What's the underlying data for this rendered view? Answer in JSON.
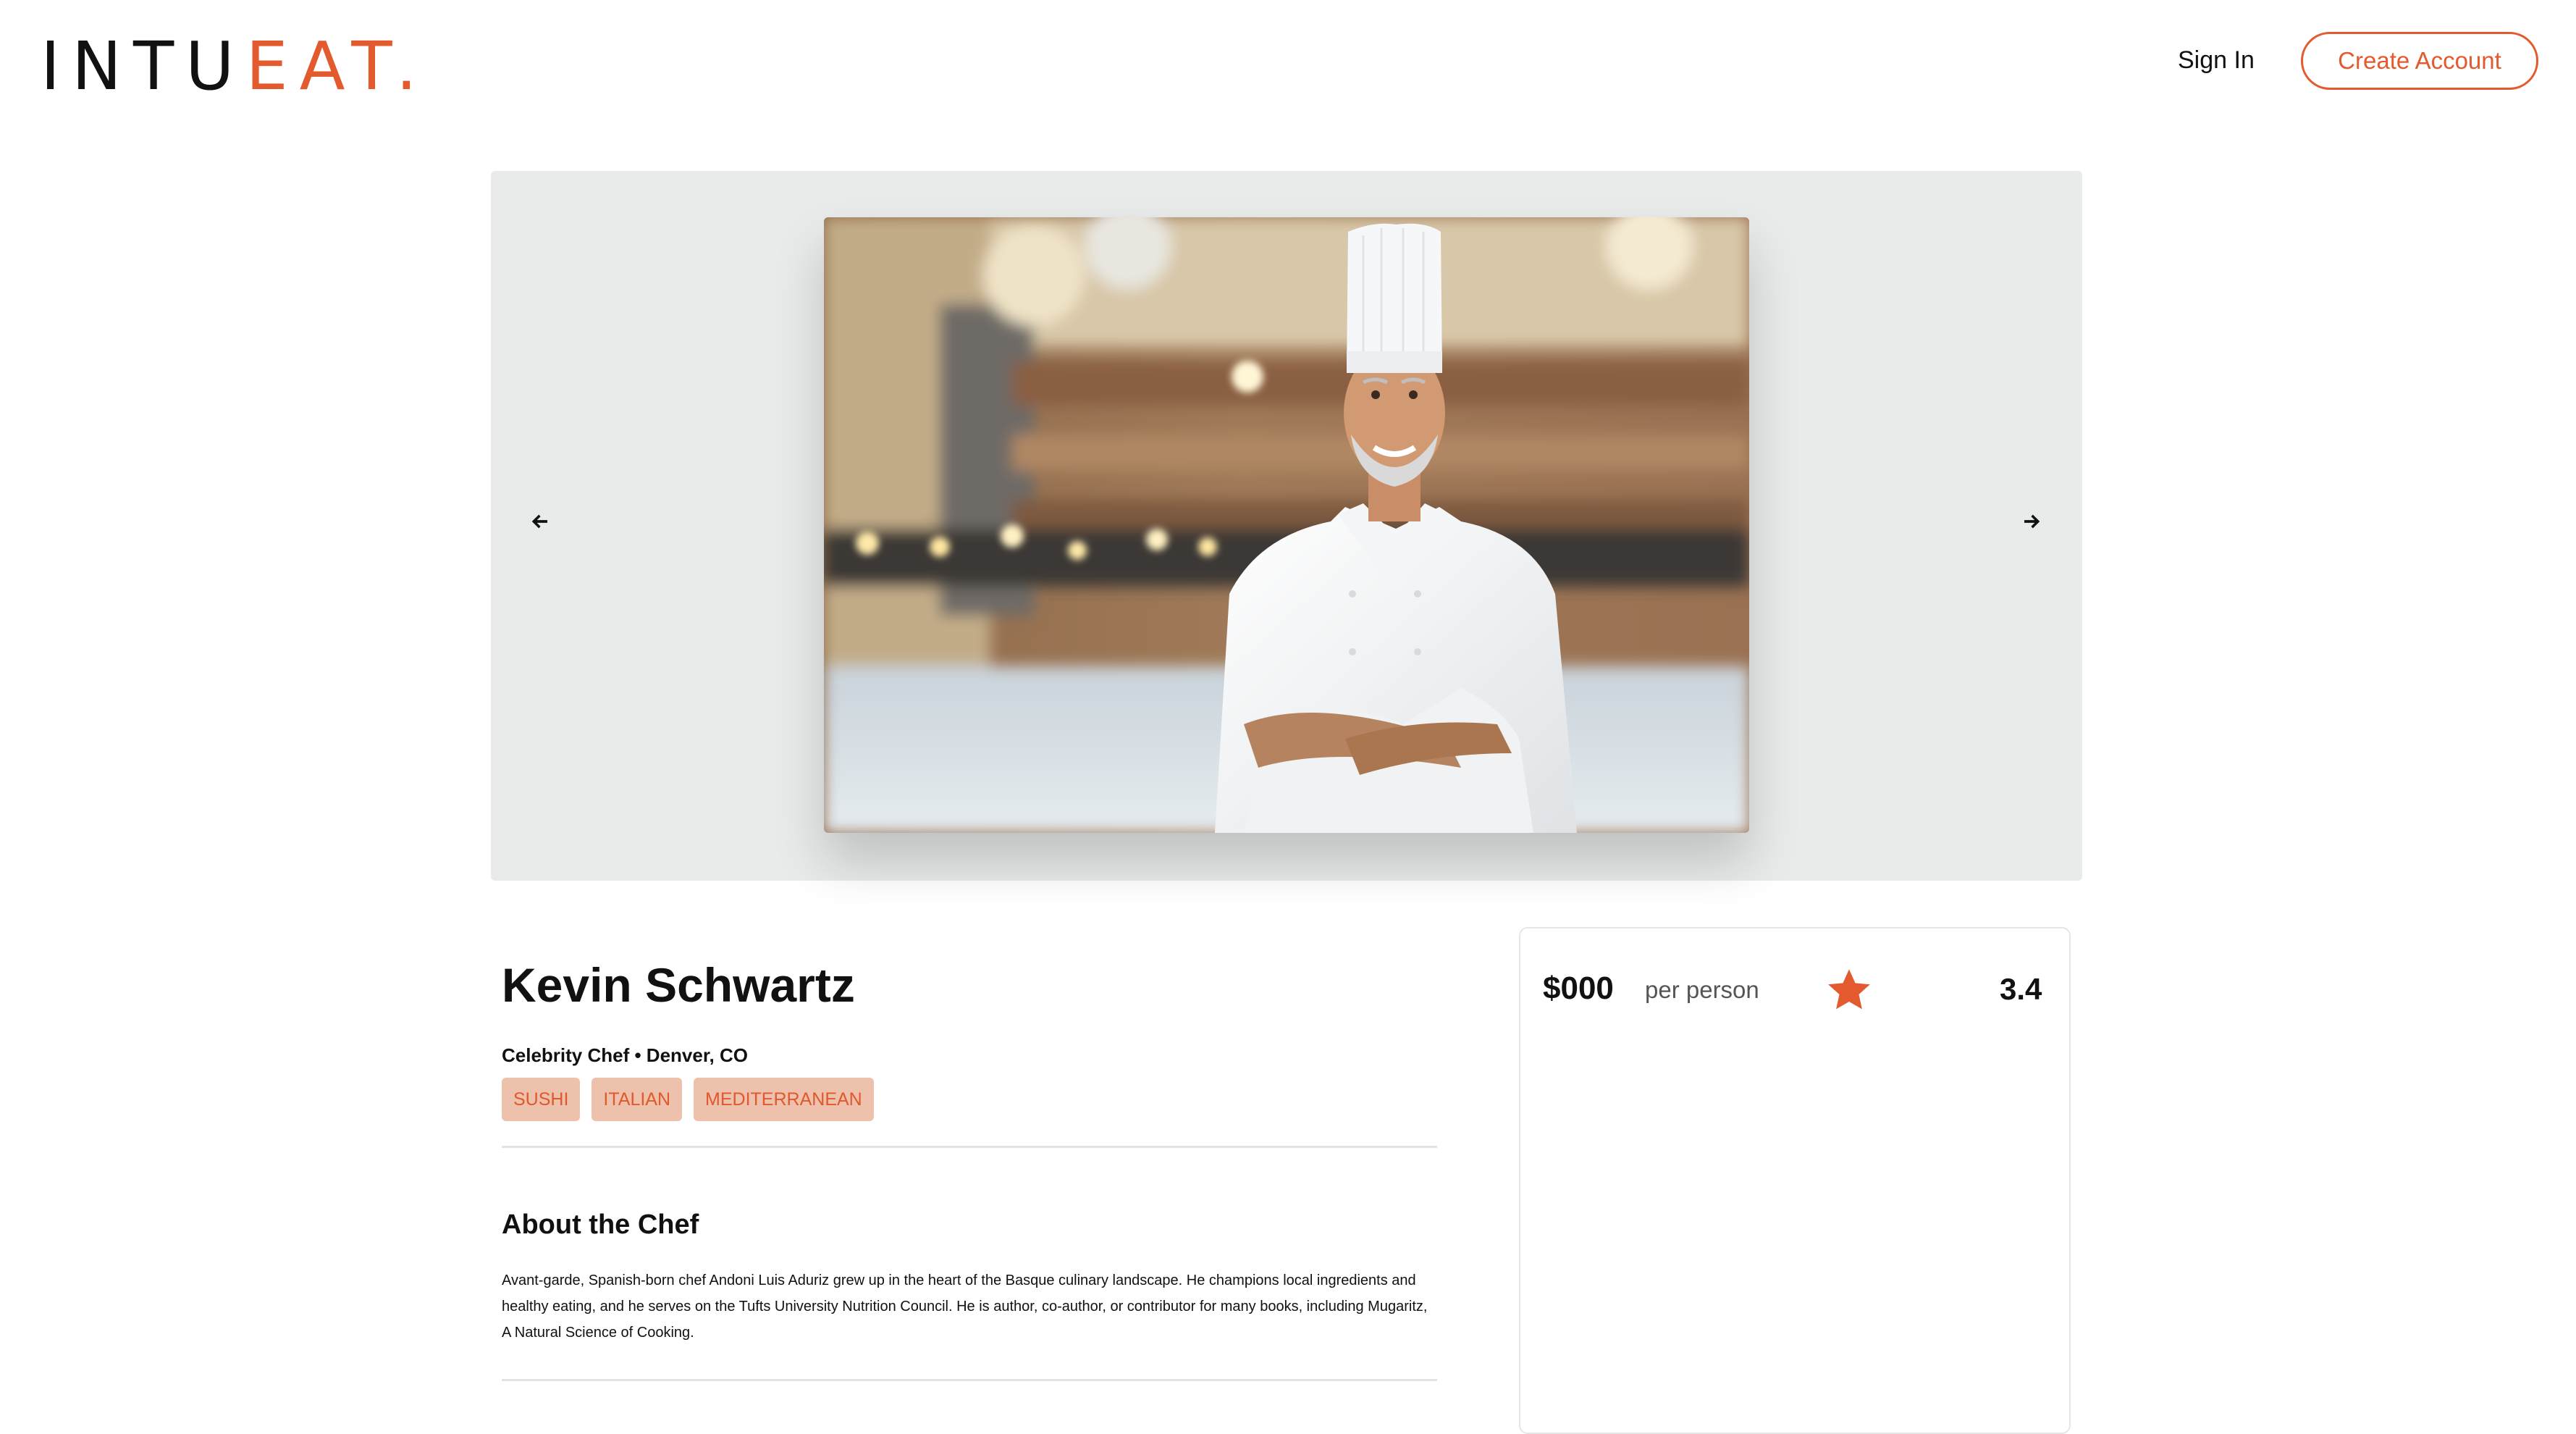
{
  "header": {
    "logo_main": "INTU",
    "logo_accent": "EAT.",
    "sign_in_label": "Sign In",
    "create_account_label": "Create Account"
  },
  "carousel": {
    "prev_icon": "arrow-left-icon",
    "next_icon": "arrow-right-icon",
    "image_subject": "chef-portrait"
  },
  "chef": {
    "name": "Kevin Schwartz",
    "subtitle": "Celebrity Chef • Denver, CO",
    "tags": [
      "SUSHI",
      "ITALIAN",
      "MEDITERRANEAN"
    ],
    "about_title": "About the Chef",
    "about_text": "Avant-garde, Spanish-born chef Andoni Luis Aduriz grew up in the heart of the Basque culinary landscape. He champions local ingredients and healthy eating, and he serves on the Tufts University Nutrition Council. He is author, co-author, or contributor for many books, including Mugaritz, A Natural Science of Cooking."
  },
  "pricing": {
    "price": "$000",
    "unit": "per person",
    "rating": "3.4",
    "rating_icon": "star-icon"
  },
  "colors": {
    "accent": "#e35a2e",
    "tag_bg": "#eec1ad",
    "carousel_bg": "#e9eaea"
  }
}
